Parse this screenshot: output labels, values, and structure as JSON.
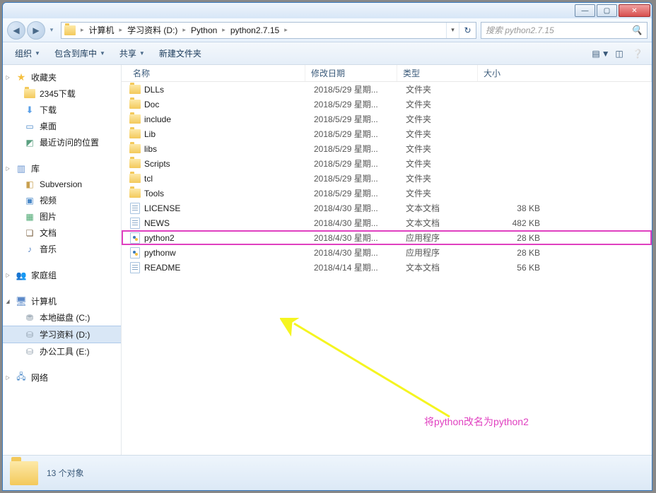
{
  "titlebar": {
    "min": "—",
    "max": "▢",
    "close": "✕"
  },
  "nav": {
    "back": "◀",
    "fwd": "▶",
    "drop": "▾",
    "refresh": "↻"
  },
  "breadcrumbs": [
    "计算机",
    "学习资料 (D:)",
    "Python",
    "python2.7.15"
  ],
  "search": {
    "placeholder": "搜索 python2.7.15",
    "icon": "🔍"
  },
  "toolbar": {
    "organize": "组织",
    "include": "包含到库中",
    "share": "共享",
    "newfolder": "新建文件夹"
  },
  "sidebar": {
    "favorites": {
      "label": "收藏夹",
      "items": [
        {
          "id": "dl2345",
          "label": "2345下载",
          "icon": "fold"
        },
        {
          "id": "downloads",
          "label": "下载",
          "icon": "dl",
          "glyph": "⬇"
        },
        {
          "id": "desktop",
          "label": "桌面",
          "icon": "desk",
          "glyph": "▭"
        },
        {
          "id": "recent",
          "label": "最近访问的位置",
          "icon": "recent",
          "glyph": "◩"
        }
      ]
    },
    "libraries": {
      "label": "库",
      "items": [
        {
          "id": "svn",
          "label": "Subversion",
          "icon": "svn",
          "glyph": "◧"
        },
        {
          "id": "videos",
          "label": "视频",
          "icon": "vid",
          "glyph": "▣"
        },
        {
          "id": "pictures",
          "label": "图片",
          "icon": "pic",
          "glyph": "▦"
        },
        {
          "id": "documents",
          "label": "文档",
          "icon": "doc",
          "glyph": "❏"
        },
        {
          "id": "music",
          "label": "音乐",
          "icon": "mus",
          "glyph": "♪"
        }
      ]
    },
    "homegroup": {
      "label": "家庭组",
      "glyph": "👥"
    },
    "computer": {
      "label": "计算机",
      "glyph": "🖥",
      "items": [
        {
          "id": "disk-c",
          "label": "本地磁盘 (C:)",
          "icon": "disk",
          "glyph": "⛃",
          "selected": false
        },
        {
          "id": "disk-d",
          "label": "学习资料 (D:)",
          "icon": "disk",
          "glyph": "⛁",
          "selected": true
        },
        {
          "id": "disk-e",
          "label": "办公工具 (E:)",
          "icon": "disk",
          "glyph": "⛁",
          "selected": false
        }
      ]
    },
    "network": {
      "label": "网络",
      "glyph": "🖧"
    }
  },
  "columns": {
    "name": "名称",
    "date": "修改日期",
    "type": "类型",
    "size": "大小"
  },
  "files": [
    {
      "icon": "fold",
      "name": "DLLs",
      "date": "2018/5/29 星期...",
      "type": "文件夹",
      "size": ""
    },
    {
      "icon": "fold",
      "name": "Doc",
      "date": "2018/5/29 星期...",
      "type": "文件夹",
      "size": ""
    },
    {
      "icon": "fold",
      "name": "include",
      "date": "2018/5/29 星期...",
      "type": "文件夹",
      "size": ""
    },
    {
      "icon": "fold",
      "name": "Lib",
      "date": "2018/5/29 星期...",
      "type": "文件夹",
      "size": ""
    },
    {
      "icon": "fold",
      "name": "libs",
      "date": "2018/5/29 星期...",
      "type": "文件夹",
      "size": ""
    },
    {
      "icon": "fold",
      "name": "Scripts",
      "date": "2018/5/29 星期...",
      "type": "文件夹",
      "size": ""
    },
    {
      "icon": "fold",
      "name": "tcl",
      "date": "2018/5/29 星期...",
      "type": "文件夹",
      "size": ""
    },
    {
      "icon": "fold",
      "name": "Tools",
      "date": "2018/5/29 星期...",
      "type": "文件夹",
      "size": ""
    },
    {
      "icon": "txt",
      "name": "LICENSE",
      "date": "2018/4/30 星期...",
      "type": "文本文档",
      "size": "38 KB"
    },
    {
      "icon": "txt",
      "name": "NEWS",
      "date": "2018/4/30 星期...",
      "type": "文本文档",
      "size": "482 KB"
    },
    {
      "icon": "py",
      "name": "python2",
      "date": "2018/4/30 星期...",
      "type": "应用程序",
      "size": "28 KB",
      "highlight": true
    },
    {
      "icon": "py",
      "name": "pythonw",
      "date": "2018/4/30 星期...",
      "type": "应用程序",
      "size": "28 KB"
    },
    {
      "icon": "txt",
      "name": "README",
      "date": "2018/4/14 星期...",
      "type": "文本文档",
      "size": "56 KB"
    }
  ],
  "annotation": "将python改名为python2",
  "details": {
    "count": "13 个对象"
  },
  "annotation_color": "#e040c0"
}
